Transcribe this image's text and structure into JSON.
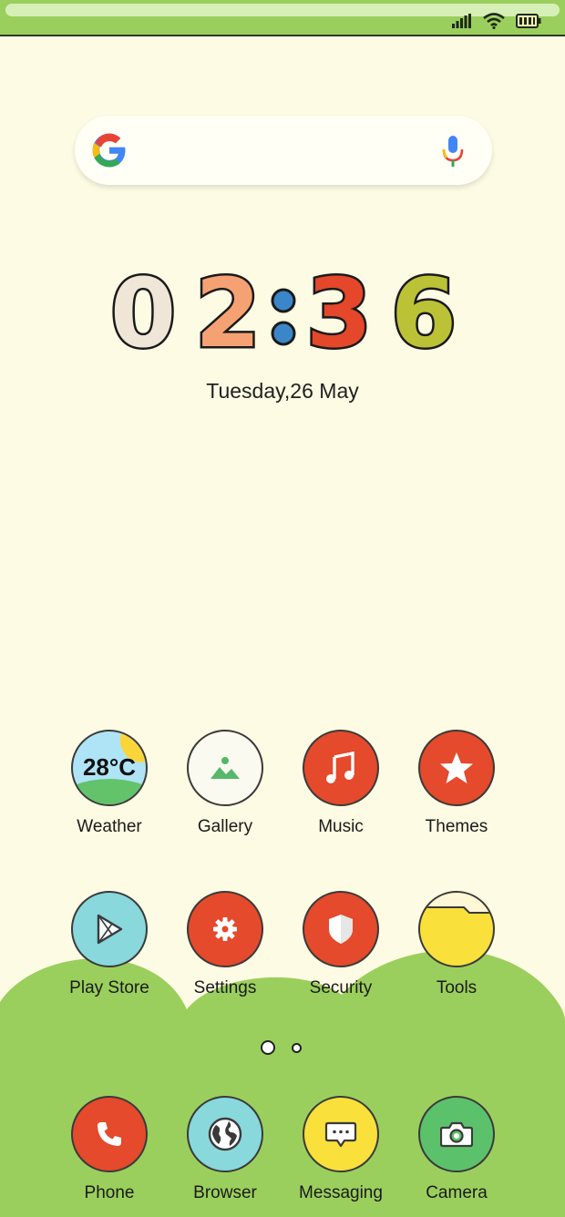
{
  "status_bar": {
    "icons": [
      "signal-icon",
      "wifi-icon",
      "battery-icon"
    ]
  },
  "search": {
    "icons": [
      "google-logo-icon",
      "microphone-icon"
    ]
  },
  "clock": {
    "hours": "02",
    "minutes": "36",
    "digits": [
      "0",
      "2",
      "3",
      "6"
    ],
    "separator": ":",
    "date": "Tuesday,26 May"
  },
  "apps": [
    {
      "label": "Weather",
      "icon": "weather-icon",
      "temp": "28°C"
    },
    {
      "label": "Gallery",
      "icon": "gallery-icon"
    },
    {
      "label": "Music",
      "icon": "music-note-icon"
    },
    {
      "label": "Themes",
      "icon": "star-icon"
    },
    {
      "label": "Play Store",
      "icon": "play-store-icon"
    },
    {
      "label": "Settings",
      "icon": "gear-icon"
    },
    {
      "label": "Security",
      "icon": "shield-icon"
    },
    {
      "label": "Tools",
      "icon": "folder-icon"
    }
  ],
  "dock": [
    {
      "label": "Phone",
      "icon": "phone-icon"
    },
    {
      "label": "Browser",
      "icon": "globe-icon"
    },
    {
      "label": "Messaging",
      "icon": "message-icon"
    },
    {
      "label": "Camera",
      "icon": "camera-icon"
    }
  ],
  "page_indicator": {
    "current": 1,
    "total": 2
  },
  "colors": {
    "background": "#fdfbe3",
    "hill_green": "#9bcf5d",
    "accent_red": "#e44a2b",
    "cyan": "#88d8dc",
    "yellow": "#f9e03a",
    "green": "#5cc16b"
  }
}
